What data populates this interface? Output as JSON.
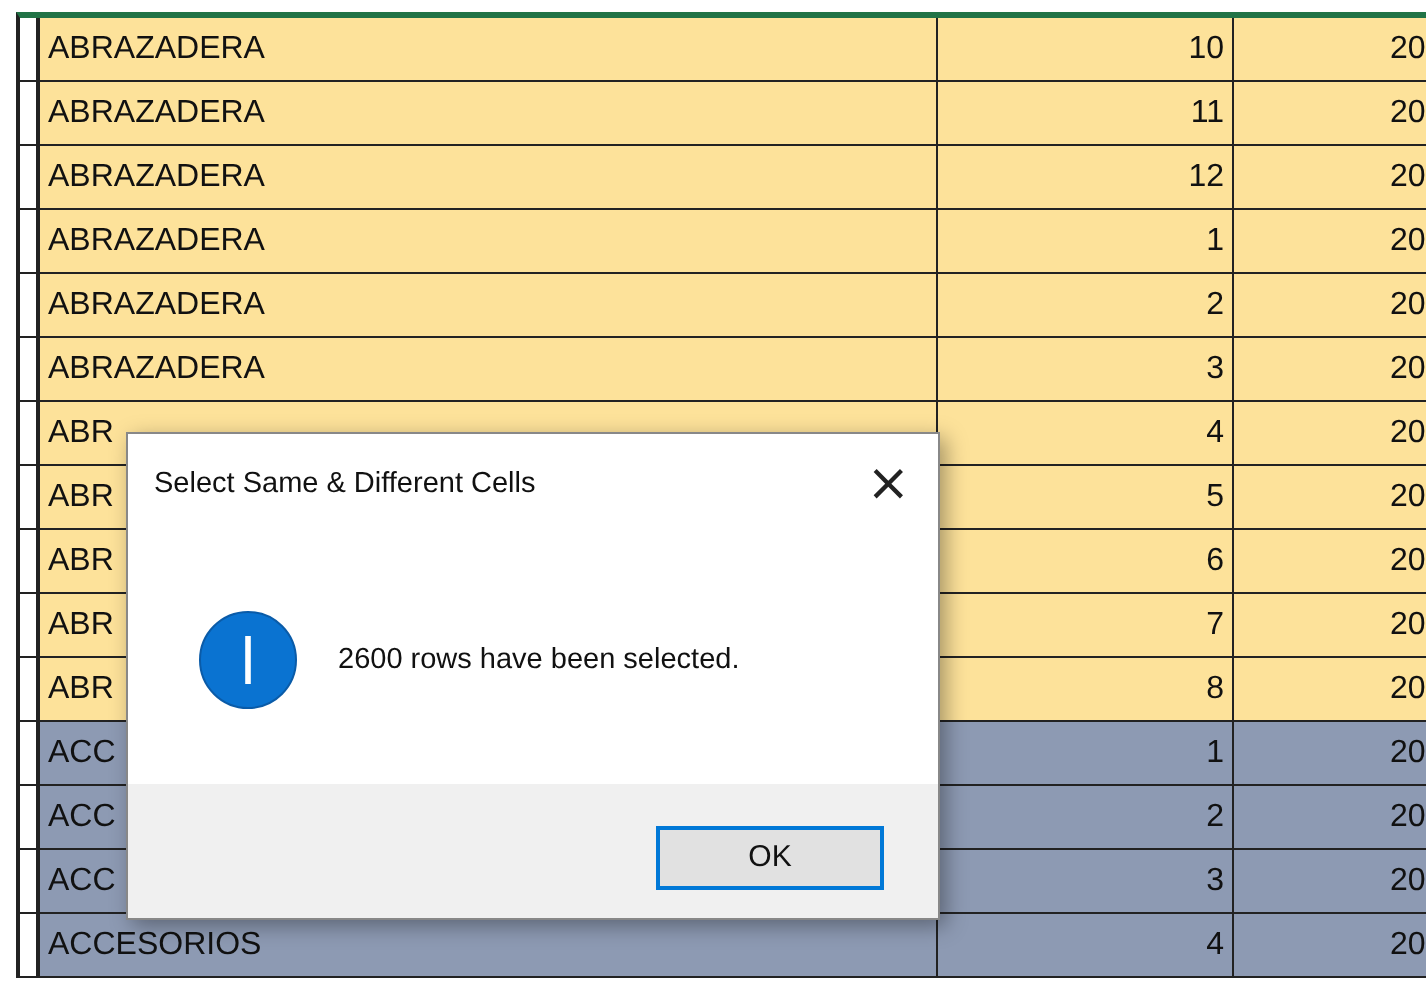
{
  "sheet": {
    "rows": [
      {
        "column_1": "ABRAZADERA",
        "column_2": "10",
        "column_3": "20",
        "selected": false
      },
      {
        "column_1": "ABRAZADERA",
        "column_2": "11",
        "column_3": "20",
        "selected": false
      },
      {
        "column_1": "ABRAZADERA",
        "column_2": "12",
        "column_3": "20",
        "selected": false
      },
      {
        "column_1": "ABRAZADERA",
        "column_2": "1",
        "column_3": "20",
        "selected": false
      },
      {
        "column_1": "ABRAZADERA",
        "column_2": "2",
        "column_3": "20",
        "selected": false
      },
      {
        "column_1": "ABRAZADERA",
        "column_2": "3",
        "column_3": "20",
        "selected": false
      },
      {
        "column_1": "ABR",
        "column_2": "4",
        "column_3": "20",
        "selected": false
      },
      {
        "column_1": "ABR",
        "column_2": "5",
        "column_3": "20",
        "selected": false
      },
      {
        "column_1": "ABR",
        "column_2": "6",
        "column_3": "20",
        "selected": false
      },
      {
        "column_1": "ABR",
        "column_2": "7",
        "column_3": "20",
        "selected": false
      },
      {
        "column_1": "ABR",
        "column_2": "8",
        "column_3": "20",
        "selected": false
      },
      {
        "column_1": "ACC",
        "column_2": "1",
        "column_3": "20",
        "selected": true
      },
      {
        "column_1": "ACC",
        "column_2": "2",
        "column_3": "20",
        "selected": true
      },
      {
        "column_1": "ACC",
        "column_2": "3",
        "column_3": "20",
        "selected": true
      },
      {
        "column_1": "ACCESORIOS",
        "column_2": "4",
        "column_3": "20",
        "selected": true
      }
    ]
  },
  "dialog": {
    "title": "Select Same & Different Cells",
    "close": "×",
    "message": "2600 rows have been selected.",
    "buttons": [
      "OK"
    ]
  }
}
